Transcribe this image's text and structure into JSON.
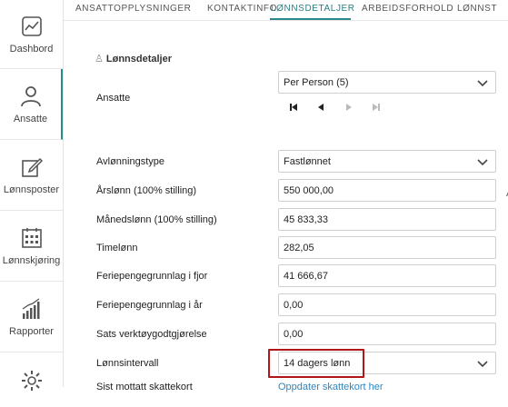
{
  "sidebar": {
    "items": [
      {
        "label": "Dashbord",
        "icon": "dashboard-icon"
      },
      {
        "label": "Ansatte",
        "icon": "person-icon"
      },
      {
        "label": "Lønnsposter",
        "icon": "edit-icon"
      },
      {
        "label": "Lønnskjøring",
        "icon": "calendar-icon"
      },
      {
        "label": "Rapporter",
        "icon": "bar-chart-icon"
      },
      {
        "label": "",
        "icon": "gear-icon"
      }
    ],
    "accent": "#2a8a8a"
  },
  "tabs": [
    {
      "label": "ANSATTOPPLYSNINGER"
    },
    {
      "label": "KONTAKTINFO"
    },
    {
      "label": "LØNNSDETALJER"
    },
    {
      "label": "ARBEIDSFORHOLD"
    },
    {
      "label": "LØNNST"
    }
  ],
  "section": {
    "title": "Lønnsdetaljer",
    "icon": "person-outline-icon"
  },
  "employee": {
    "label": "Ansatte",
    "selected": "Per  Person  (5)"
  },
  "fields": {
    "avlonningstype": {
      "label": "Avlønningstype",
      "value": "Fastlønnet"
    },
    "arslonn": {
      "label": "Årslønn (100% stilling)",
      "value": "550 000,00"
    },
    "manedslonn": {
      "label": "Månedslønn (100% stilling)",
      "value": "45 833,33"
    },
    "timelonn": {
      "label": "Timelønn",
      "value": "282,05"
    },
    "feriepenger_fjor": {
      "label": "Feriepengegrunnlag i fjor",
      "value": "41 666,67"
    },
    "feriepenger_ar": {
      "label": "Feriepengegrunnlag i år",
      "value": "0,00"
    },
    "sats_verktoy": {
      "label": "Sats verktøygodtgjørelse",
      "value": "0,00"
    },
    "lonnsintervall": {
      "label": "Lønnsintervall",
      "value": "14 dagers lønn"
    },
    "skattekort": {
      "label": "Sist mottatt skattekort",
      "link": "Oppdater skattekort her"
    }
  },
  "stray_text": "A",
  "colors": {
    "highlight": "#b0151a",
    "link": "#2e86c1"
  }
}
